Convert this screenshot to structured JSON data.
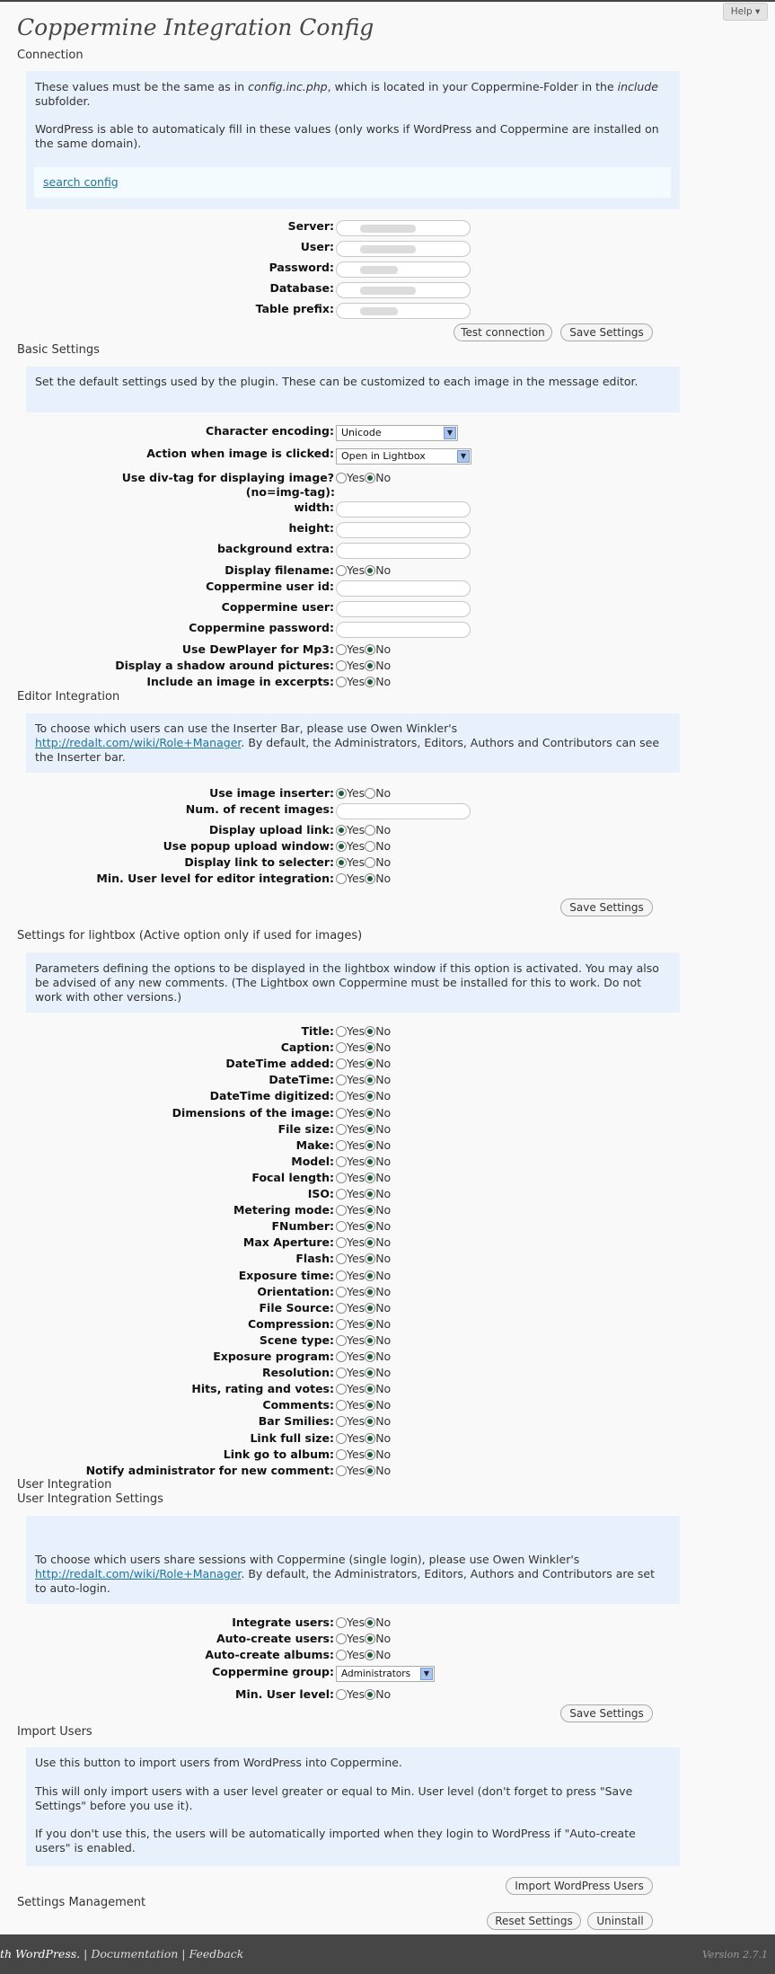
{
  "header": {
    "title": "Coppermine Integration Config",
    "help": "Help ▾"
  },
  "connection": {
    "heading": "Connection",
    "info1_pre": "These values must be the same as in ",
    "info1_file": "config.inc.php",
    "info1_mid": ", which is located in your Coppermine-Folder in the ",
    "info1_dir": "include",
    "info1_post": " subfolder.",
    "info2": "WordPress is able to automaticaly fill in these values (only works if WordPress and Coppermine are installed on the same domain).",
    "search_link": "search config",
    "fields": [
      {
        "label": "Server:"
      },
      {
        "label": "User:"
      },
      {
        "label": "Password:"
      },
      {
        "label": "Database:"
      },
      {
        "label": "Table prefix:"
      }
    ],
    "test_button": "Test connection",
    "save_button": "Save Settings"
  },
  "basic": {
    "heading": "Basic Settings",
    "info": "Set the default settings used by the plugin. These can be customized to each image in the message editor.",
    "encoding_label": "Character encoding:",
    "encoding_value": "Unicode",
    "action_label": "Action when image is clicked:",
    "action_value": "Open in Lightbox",
    "divtag_label1": "Use div-tag for displaying image?",
    "divtag_label2": "(no=img-tag):",
    "width_label": "width:",
    "height_label": "height:",
    "bgextra_label": "background extra:",
    "filename_label": "Display filename:",
    "cpg_userid_label": "Coppermine user id:",
    "cpg_user_label": "Coppermine user:",
    "cpg_pass_label": "Coppermine password:",
    "dew_label": "Use DewPlayer for Mp3:",
    "shadow_label": "Display a shadow around pictures:",
    "excerpt_label": "Include an image in excerpts:"
  },
  "yes": "Yes",
  "no": "No",
  "editor": {
    "heading": "Editor Integration",
    "info_pre": "To choose which users can use the Inserter Bar, please use Owen Winkler's ",
    "info_link": "http://redalt.com/wiki/Role+Manager",
    "info_post": ". By default, the Administrators, Editors, Authors and Contributors can see the Inserter bar.",
    "inserter_label": "Use image inserter:",
    "recent_label": "Num. of recent images:",
    "upload_link_label": "Display upload link:",
    "popup_label": "Use popup upload window:",
    "selecter_label": "Display link to selecter:",
    "minlevel_label": "Min. User level for editor integration:",
    "save_button": "Save Settings"
  },
  "lightbox": {
    "heading": "Settings for lightbox (Active option only if used for images)",
    "info": "Parameters defining the options to be displayed in the lightbox window if this option is activated. You may also be advised of any new comments. (The Lightbox own Coppermine must be installed for this to work. Do not work with other versions.)",
    "options": [
      "Title:",
      "Caption:",
      "DateTime added:",
      "DateTime:",
      "DateTime digitized:",
      "Dimensions of the image:",
      "File size:",
      "Make:",
      "Model:",
      "Focal length:",
      "ISO:",
      "Metering mode:",
      "FNumber:",
      "Max Aperture:",
      "Flash:",
      "Exposure time:",
      "Orientation:",
      "File Source:",
      "Compression:",
      "Scene type:",
      "Exposure program:",
      "Resolution:",
      "Hits, rating and votes:",
      "Comments:",
      "Bar Smilies:",
      "Link full size:",
      "Link go to album:",
      "Notify administrator for new comment:"
    ]
  },
  "userint": {
    "heading": "User Integration",
    "subheading": "User Integration Settings",
    "info_pre": "To choose which users share sessions with Coppermine (single login), please use Owen Winkler's ",
    "info_link": "http://redalt.com/wiki/Role+Manager",
    "info_post": ". By default, the Administrators, Editors, Authors and Contributors are set to auto-login.",
    "integrate_label": "Integrate users:",
    "autousers_label": "Auto-create users:",
    "autoalbums_label": "Auto-create albums:",
    "group_label": "Coppermine group:",
    "group_value": "Administrators",
    "minlevel_label": "Min. User level:",
    "save_button": "Save Settings"
  },
  "import": {
    "heading": "Import Users",
    "info1": "Use this button to import users from WordPress into Coppermine.",
    "info2": "This will only import users with a user level greater or equal to Min. User level (don't forget to press \"Save Settings\" before you use it).",
    "info3": "If you don't use this, the users will be automatically imported when they login to WordPress if \"Auto-create users\" is enabled.",
    "button": "Import WordPress Users"
  },
  "management": {
    "heading": "Settings Management",
    "reset_button": "Reset Settings",
    "uninstall_button": "Uninstall"
  },
  "footer": {
    "text": "th WordPress.",
    "sep1": " | ",
    "docs": "Documentation",
    "sep2": " | ",
    "feedback": "Feedback",
    "version": "Version 2.7.1"
  }
}
